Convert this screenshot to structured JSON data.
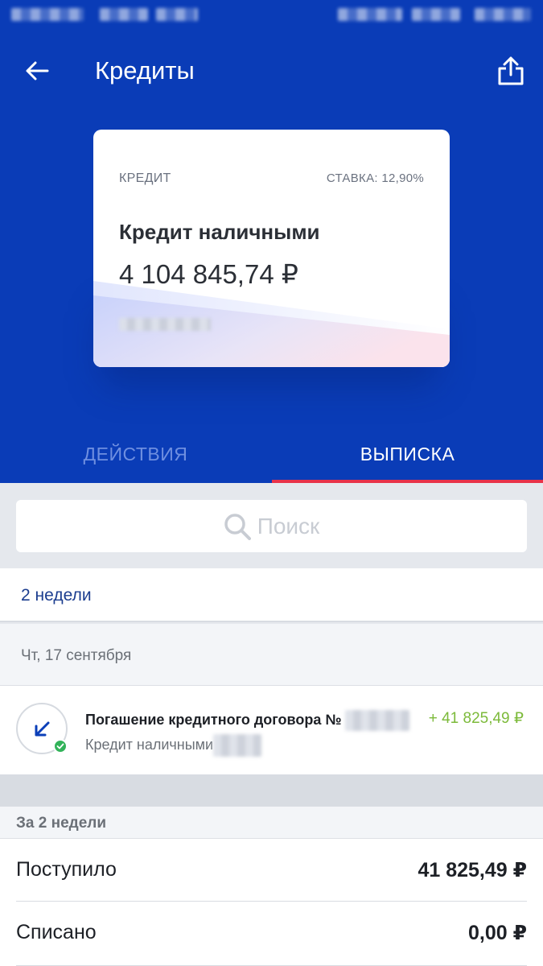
{
  "header": {
    "title": "Кредиты",
    "back_icon": "arrow-left-icon",
    "share_icon": "share-icon",
    "background": "#0a3cb7"
  },
  "card": {
    "type": "КРЕДИТ",
    "rate": "СТАВКА: 12,90%",
    "name": "Кредит наличными",
    "amount": "4 104 845,74 ₽"
  },
  "tabs": [
    {
      "label": "ДЕЙСТВИЯ",
      "active": false
    },
    {
      "label": "ВЫПИСКА",
      "active": true
    }
  ],
  "search": {
    "placeholder": "Поиск"
  },
  "filter": {
    "period": "2 недели"
  },
  "transactions": [
    {
      "date": "Чт, 17 сентября",
      "title": "Погашение кредитного договора №",
      "subtitle": "Кредит наличными",
      "amount": "+ 41 825,49 ₽",
      "amount_color": "#7cba3a"
    }
  ],
  "summary": {
    "heading": "За 2 недели",
    "rows": [
      {
        "label": "Поступило",
        "value": "41 825,49 ₽"
      },
      {
        "label": "Списано",
        "value": "0,00 ₽"
      }
    ]
  }
}
